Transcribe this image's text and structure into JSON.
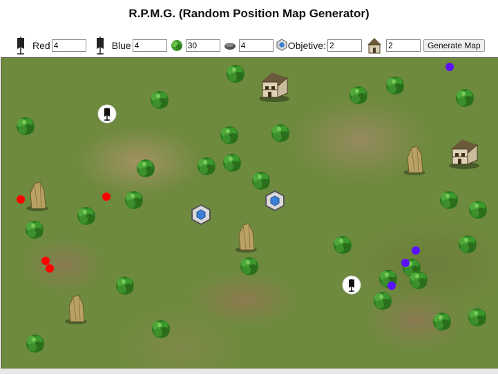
{
  "title": "R.P.M.G. (Random Position Map Generator)",
  "toolbar": {
    "red_label": "Red",
    "red_value": "4",
    "blue_label": "Blue",
    "blue_value": "4",
    "trees_value": "30",
    "rocks_value": "4",
    "objective_label": "Objetive:",
    "objective_value": "2",
    "houses_value": "2",
    "generate_label": "Generate Map"
  },
  "icons": {
    "red_team": "banner-icon",
    "blue_team": "banner-icon",
    "trees": "tree-icon",
    "rocks": "rock-icon",
    "objective": "hexagon-objective-icon",
    "houses": "house-icon"
  },
  "colors": {
    "red_unit": "#ff0000",
    "blue_unit": "#5a12ff",
    "grass": "#6e8a3e",
    "objective": "#3b7fd6"
  }
}
